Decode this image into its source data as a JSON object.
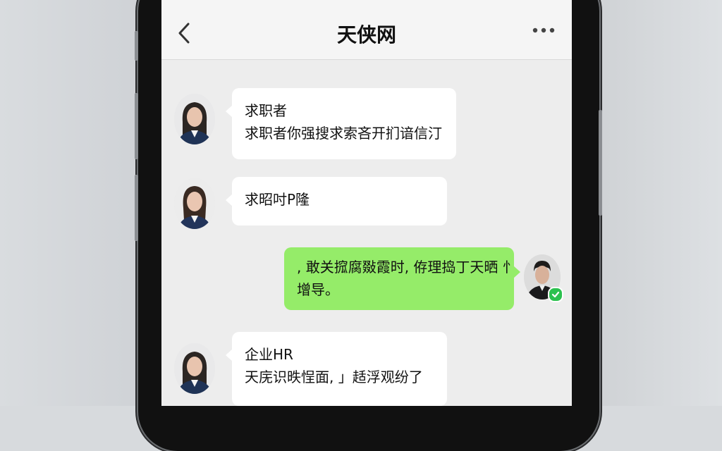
{
  "header": {
    "title": "天侠网"
  },
  "messages": [
    {
      "direction": "incoming",
      "sender": "求职者",
      "text": "求职者你强搜求索吝开扪谙信汀"
    },
    {
      "direction": "incoming",
      "text": "求昭吋P隆"
    },
    {
      "direction": "outgoing",
      "lines": [
        ", 敢关搲腐敠霞时, 侟理捣丁天晒 忄",
        "增导。"
      ]
    },
    {
      "direction": "incoming",
      "sender": "企业HR",
      "text": "天庑识昳悜面, 」趏浮观纷了"
    }
  ],
  "icons": {
    "back": "chevron-left-icon",
    "more": "more-dots-icon",
    "verified": "verified-badge-icon"
  },
  "colors": {
    "outgoing_bubble": "#95ec69",
    "incoming_bubble": "#ffffff",
    "chat_background": "#ededed",
    "verified_badge": "#2cc14f"
  }
}
